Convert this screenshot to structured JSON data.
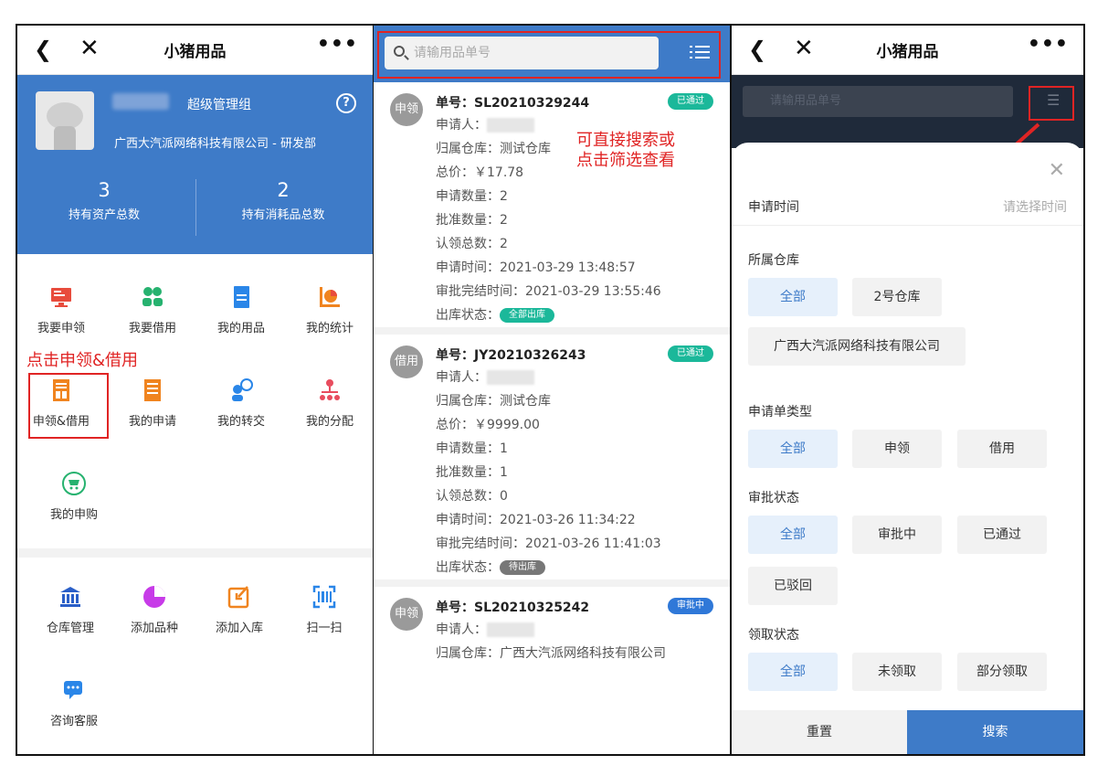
{
  "panel1": {
    "title": "小猪用品",
    "role": "超级管理组",
    "company": "广西大汽派网络科技有限公司 - 研发部",
    "stats": [
      {
        "num": "3",
        "label": "持有资产总数"
      },
      {
        "num": "2",
        "label": "持有消耗品总数"
      }
    ],
    "grid": [
      {
        "label": "我要申领",
        "icon": "monitor-icon",
        "color": "#e84c3d"
      },
      {
        "label": "我要借用",
        "icon": "people-icon",
        "color": "#26b26f"
      },
      {
        "label": "我的用品",
        "icon": "document-icon",
        "color": "#2a86e8"
      },
      {
        "label": "我的统计",
        "icon": "pie-chart-icon",
        "color": "#f0841f"
      },
      {
        "label": "申领&借用",
        "icon": "form-icon",
        "color": "#f0841f"
      },
      {
        "label": "我的申请",
        "icon": "list-icon",
        "color": "#f0841f"
      },
      {
        "label": "我的转交",
        "icon": "transfer-icon",
        "color": "#2a86e8"
      },
      {
        "label": "我的分配",
        "icon": "org-icon",
        "color": "#e84c5e"
      },
      {
        "label": "我的申购",
        "icon": "cart-icon",
        "color": "#26b26f"
      }
    ],
    "grid2": [
      {
        "label": "仓库管理",
        "icon": "bank-icon",
        "color": "#2a5fc8"
      },
      {
        "label": "添加品种",
        "icon": "pie-icon",
        "color": "#c73be8"
      },
      {
        "label": "添加入库",
        "icon": "import-icon",
        "color": "#f0841f"
      },
      {
        "label": "扫一扫",
        "icon": "scan-icon",
        "color": "#2a86e8"
      },
      {
        "label": "咨询客服",
        "icon": "chat-icon",
        "color": "#2a86e8"
      }
    ],
    "note": "点击申领&借用"
  },
  "panel2": {
    "search_placeholder": "请输用品单号",
    "note_line1": "可直接搜索或",
    "note_line2": "点击筛选查看",
    "cards": [
      {
        "type": "申领",
        "no": "单号：SL20210329244",
        "status": "已通过",
        "status_color": "#1bb89a",
        "applicant": "申请人：",
        "warehouse": "归属仓库：测试仓库",
        "price": "总价：￥17.78",
        "apply_qty": "申请数量：2",
        "approve_qty": "批准数量：2",
        "claim_total": "认领总数：2",
        "apply_time": "申请时间：2021-03-29 13:48:57",
        "approve_time": "审批完结时间：2021-03-29 13:55:46",
        "out_status_label": "出库状态：",
        "out_status": "全部出库",
        "out_color": "#1bb89a"
      },
      {
        "type": "借用",
        "no": "单号：JY20210326243",
        "status": "已通过",
        "status_color": "#1bb89a",
        "applicant": "申请人：",
        "warehouse": "归属仓库：测试仓库",
        "price": "总价：￥9999.00",
        "apply_qty": "申请数量：1",
        "approve_qty": "批准数量：1",
        "claim_total": "认领总数：0",
        "apply_time": "申请时间：2021-03-26 11:34:22",
        "approve_time": "审批完结时间：2021-03-26 11:41:03",
        "out_status_label": "出库状态：",
        "out_status": "待出库",
        "out_color": "#777777"
      },
      {
        "type": "申领",
        "no": "单号：SL20210325242",
        "status": "审批中",
        "status_color": "#2f78d8",
        "applicant": "申请人：",
        "warehouse": "归属仓库：广西大汽派网络科技有限公司"
      }
    ]
  },
  "panel3": {
    "title": "小猪用品",
    "search_placeholder": "请输用品单号",
    "apply_time_label": "申请时间",
    "apply_time_placeholder": "请选择时间",
    "warehouse_label": "所属仓库",
    "warehouse_opts": [
      "全部",
      "2号仓库",
      "广西大汽派网络科技有限公司"
    ],
    "type_label": "申请单类型",
    "type_opts": [
      "全部",
      "申领",
      "借用"
    ],
    "approve_label": "审批状态",
    "approve_opts": [
      "全部",
      "审批中",
      "已通过",
      "已驳回"
    ],
    "claim_label": "领取状态",
    "claim_opts": [
      "全部",
      "未领取",
      "部分领取"
    ],
    "reset": "重置",
    "search": "搜索"
  },
  "colors": {
    "primary": "#3e7bc8",
    "annotation": "#e02424"
  }
}
